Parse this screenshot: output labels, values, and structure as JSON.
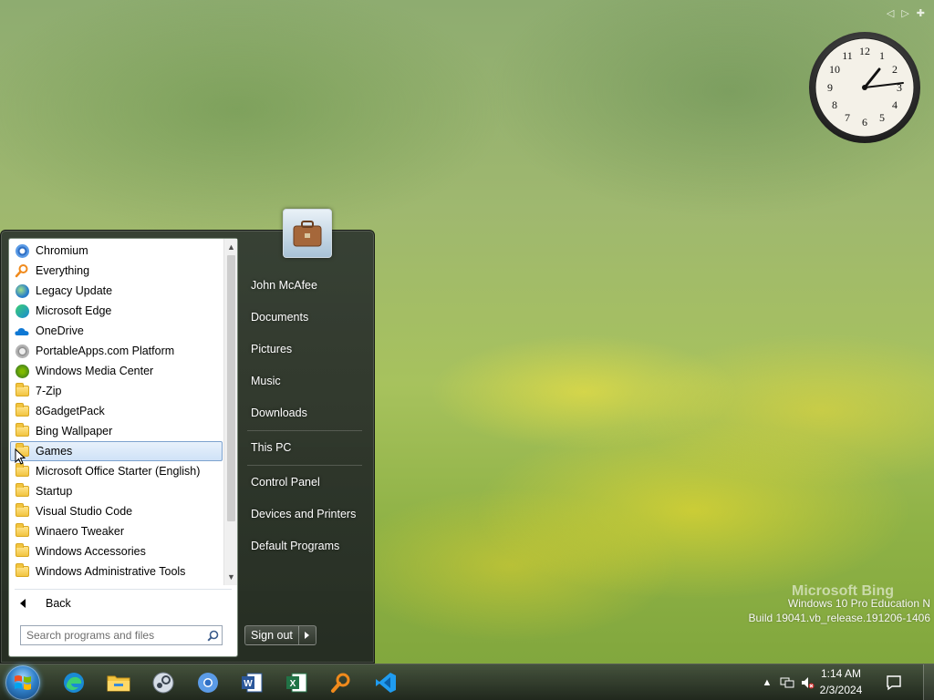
{
  "desktop": {
    "watermark_line1": "Windows 10 Pro Education N",
    "watermark_line2": "Build 19041.vb_release.191206-1406",
    "bing_mark": "Microsoft Bing"
  },
  "start_menu": {
    "programs": [
      {
        "label": "Chromium",
        "icon": "chromium-icon"
      },
      {
        "label": "Everything",
        "icon": "everything-icon"
      },
      {
        "label": "Legacy Update",
        "icon": "legacy-update-icon"
      },
      {
        "label": "Microsoft Edge",
        "icon": "edge-icon"
      },
      {
        "label": "OneDrive",
        "icon": "onedrive-icon"
      },
      {
        "label": "PortableApps.com Platform",
        "icon": "portableapps-icon"
      },
      {
        "label": "Windows Media Center",
        "icon": "media-center-icon"
      },
      {
        "label": "7-Zip",
        "icon": "folder-icon"
      },
      {
        "label": "8GadgetPack",
        "icon": "folder-icon"
      },
      {
        "label": "Bing Wallpaper",
        "icon": "folder-icon"
      },
      {
        "label": "Games",
        "icon": "folder-icon"
      },
      {
        "label": "Microsoft Office Starter (English)",
        "icon": "folder-icon"
      },
      {
        "label": "Startup",
        "icon": "folder-icon"
      },
      {
        "label": "Visual Studio Code",
        "icon": "folder-icon"
      },
      {
        "label": "Winaero Tweaker",
        "icon": "folder-icon"
      },
      {
        "label": "Windows Accessories",
        "icon": "folder-icon"
      },
      {
        "label": "Windows Administrative Tools",
        "icon": "folder-icon"
      }
    ],
    "selected": "Games",
    "back_label": "Back",
    "search_placeholder": "Search programs and files",
    "right_items": {
      "user": "John McAfee",
      "documents": "Documents",
      "pictures": "Pictures",
      "music": "Music",
      "downloads": "Downloads",
      "this_pc": "This PC",
      "control_panel": "Control Panel",
      "devices": "Devices and Printers",
      "default_programs": "Default Programs"
    },
    "sign_out": "Sign out"
  },
  "taskbar": {
    "time": "1:14 AM",
    "date": "2/3/2024",
    "pinned": [
      "edge-icon",
      "file-explorer-icon",
      "steam-icon",
      "chromium-icon",
      "word-icon",
      "excel-icon",
      "everything-icon",
      "vscode-icon"
    ]
  },
  "colors": {
    "selection_border": "#7da2ce",
    "menu_dark": "#2c342c"
  }
}
